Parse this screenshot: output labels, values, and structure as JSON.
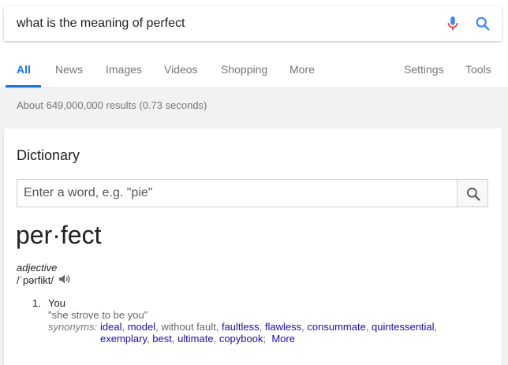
{
  "search": {
    "query": "what is the meaning of perfect"
  },
  "tabs": [
    {
      "label": "All"
    },
    {
      "label": "News"
    },
    {
      "label": "Images"
    },
    {
      "label": "Videos"
    },
    {
      "label": "Shopping"
    },
    {
      "label": "More"
    },
    {
      "label": "Settings"
    },
    {
      "label": "Tools"
    }
  ],
  "stats": "About 649,000,000 results (0.73 seconds)",
  "dictionary": {
    "title": "Dictionary",
    "input_placeholder": "Enter a word, e.g. \"pie\"",
    "word": "per·fect",
    "part_of_speech": "adjective",
    "phonetic": "/ˈpərfikt/",
    "definitions": [
      {
        "number": "1.",
        "text": "You",
        "example": "\"she strove to be you\"",
        "synonyms_label": "synonyms:",
        "synonyms": [
          {
            "text": "ideal",
            "link": true
          },
          {
            "text": "model",
            "link": true
          },
          {
            "text": "without fault",
            "link": false
          },
          {
            "text": "faultless",
            "link": true
          },
          {
            "text": "flawless",
            "link": true
          },
          {
            "text": "consummate",
            "link": true
          },
          {
            "text": "quintessential",
            "link": true
          },
          {
            "text": "exemplary",
            "link": true
          },
          {
            "text": "best",
            "link": true
          },
          {
            "text": "ultimate",
            "link": true
          },
          {
            "text": "copybook",
            "link": true
          }
        ],
        "more_label": "More"
      }
    ]
  },
  "colors": {
    "accent": "#1a73e8",
    "link": "#1a0dab",
    "mic_blue": "#4285f4",
    "mic_red": "#ea4335"
  },
  "icons": {
    "mic": "microphone-icon",
    "search": "search-icon",
    "speaker": "speaker-icon"
  }
}
